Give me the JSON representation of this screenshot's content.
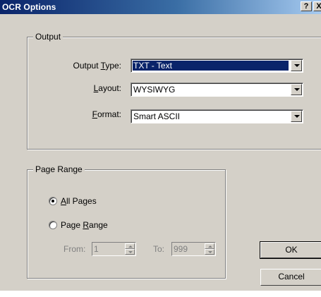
{
  "window": {
    "title": "OCR Options",
    "help_button": "?",
    "close_button": "X"
  },
  "output": {
    "group_label": "Output",
    "output_type": {
      "label_pre": "Output ",
      "label_key": "T",
      "label_post": "ype:",
      "value": "TXT - Text"
    },
    "layout": {
      "label_pre": "",
      "label_key": "L",
      "label_post": "ayout:",
      "value": "WYSIWYG"
    },
    "format": {
      "label_pre": "",
      "label_key": "F",
      "label_post": "ormat:",
      "value": "Smart ASCII"
    }
  },
  "page_range": {
    "group_label": "Page Range",
    "all_pages": {
      "label_pre": "",
      "label_key": "A",
      "label_post": "ll Pages",
      "selected": true
    },
    "range": {
      "label_pre": "Page ",
      "label_key": "R",
      "label_post": "ange",
      "selected": false
    },
    "from": {
      "label": "From:",
      "value": "1"
    },
    "to": {
      "label": "To:",
      "value": "999"
    }
  },
  "buttons": {
    "ok": "OK",
    "cancel": "Cancel"
  }
}
